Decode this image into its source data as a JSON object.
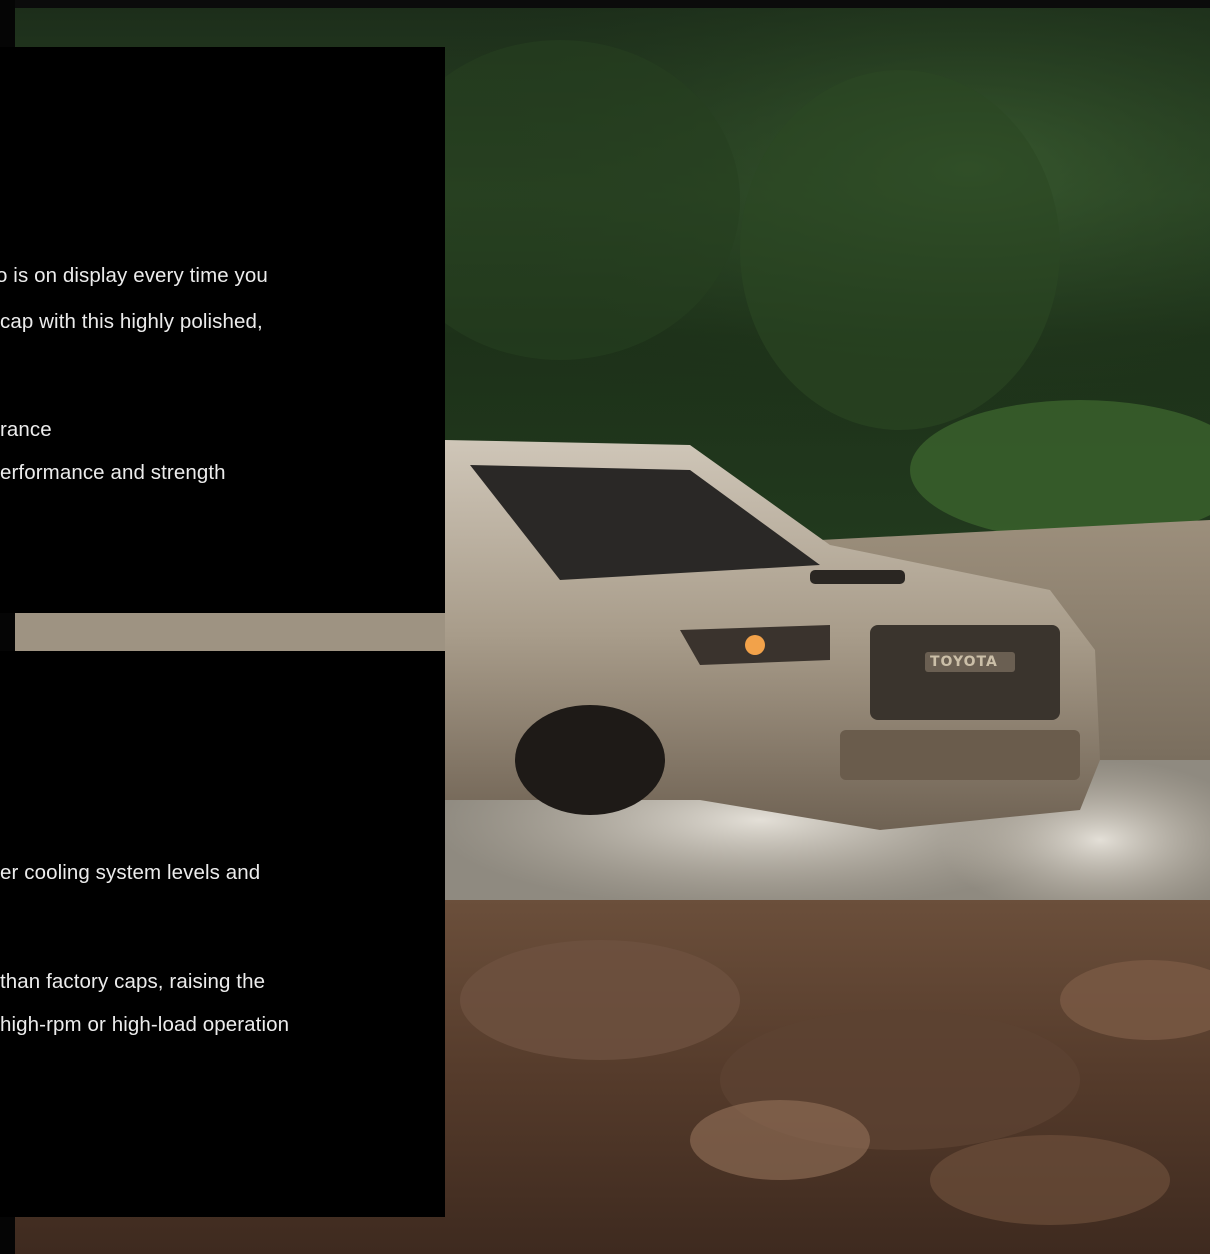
{
  "top_panel": {
    "lines": [
      "o is on display every time you",
      "cap with this highly polished,",
      "rance",
      "erformance and strength"
    ]
  },
  "bottom_panel": {
    "lines": [
      "er cooling system levels and",
      "than factory caps, raising the",
      "high-rpm or high-load operation"
    ]
  },
  "photo": {
    "grille_text": "TOYOTA"
  }
}
